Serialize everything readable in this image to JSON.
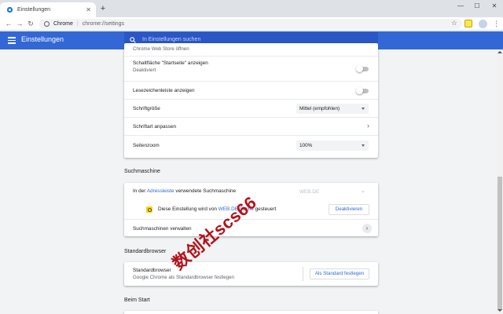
{
  "browser": {
    "tab_title": "Einstellungen",
    "tab_close": "✕",
    "new_tab": "+",
    "window_controls": [
      "—",
      "☐",
      "✕"
    ],
    "omnibox": {
      "site_label": "Chrome",
      "separator": "|",
      "url": "chrome://settings"
    },
    "icons": [
      "back-arrow-icon",
      "forward-arrow-icon",
      "reload-icon",
      "info-icon",
      "star-icon",
      "extension-icon",
      "profile-avatar-icon",
      "menu-icon"
    ]
  },
  "appbar": {
    "title": "Einstellungen",
    "search_placeholder": "In Einstellungen suchen",
    "color": "#3367d6"
  },
  "appearance": {
    "partial_row": "Chrome Web Store öffnen",
    "home_button": {
      "label": "Schaltfläche \"Startseite\" anzeigen",
      "status": "Deaktiviert",
      "enabled": false
    },
    "bookmarks_bar": {
      "label": "Lesezeichenleiste anzeigen",
      "enabled": false
    },
    "font_size": {
      "label": "Schriftgröße",
      "value": "Mittel (empfohlen)"
    },
    "customize_fonts": {
      "label": "Schriftart anpassen"
    },
    "page_zoom": {
      "label": "Seitenzoom",
      "value": "100%"
    }
  },
  "search_engine": {
    "heading": "Suchmaschine",
    "row_prefix": "In der",
    "row_link": "Adressleiste",
    "row_suffix": "verwendete Suchmaschine",
    "value": "WEB.DE",
    "policy_prefix": "Diese Einstellung wird von",
    "policy_link": "WEB.DE Suche",
    "policy_suffix": "gesteuert",
    "disable_button": "Deaktivieren",
    "manage_label": "Suchmaschinen verwalten"
  },
  "default_browser": {
    "heading": "Standardbrowser",
    "title": "Standardbrowser",
    "description": "Google Chrome als Standardbrowser festlegen",
    "button": "Als Standard festlegen"
  },
  "on_startup": {
    "heading": "Beim Start"
  },
  "watermark": "数创社scs66"
}
